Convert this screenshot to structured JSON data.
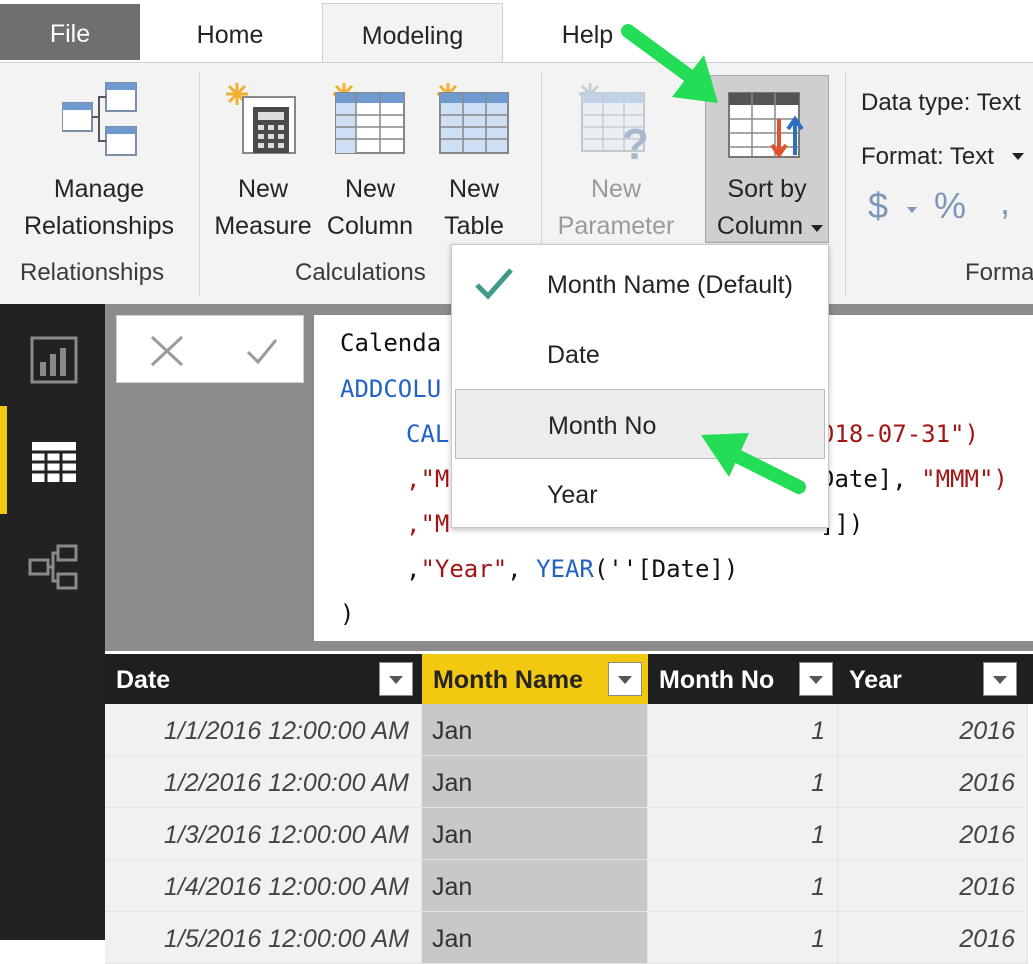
{
  "tabs": {
    "file": "File",
    "home": "Home",
    "modeling": "Modeling",
    "help": "Help"
  },
  "ribbon": {
    "manage": {
      "line1": "Manage",
      "line2": "Relationships"
    },
    "relationships_group": "Relationships",
    "new_measure": {
      "line1": "New",
      "line2": "Measure"
    },
    "new_column": {
      "line1": "New",
      "line2": "Column"
    },
    "new_table": {
      "line1": "New",
      "line2": "Table"
    },
    "calculations_group": "Calculations",
    "new_parameter": {
      "line1": "New",
      "line2": "Parameter"
    },
    "sort_by": {
      "line1": "Sort by",
      "line2": "Column"
    },
    "data_type": "Data type: Text",
    "format": "Format: Text",
    "currency_symbol": "$",
    "percent_symbol": "%",
    "comma_symbol": ",",
    "formatting_group": "Forma"
  },
  "dropdown": {
    "items": [
      "Month Name (Default)",
      "Date",
      "Month No",
      "Year"
    ],
    "checked": "Month Name (Default)",
    "highlighted": "Month No"
  },
  "formula": {
    "line1": "Calenda",
    "line2": "ADDCOLU",
    "line3a": "CAL",
    "line3b": "018-07-31\")",
    "line4a": ",\"M",
    "line4b": "Date], ",
    "line4c": "\"MMM\")",
    "line5a": ",\"M",
    "line5b": "]])",
    "line6a": ",",
    "line6b": "\"Year\"",
    "line6c": ", ",
    "line6d": "YEAR",
    "line6e": "(''[Date])",
    "line7": ")"
  },
  "table": {
    "headers": [
      "Date",
      "Month Name",
      "Month No",
      "Year"
    ],
    "rows": [
      [
        "1/1/2016 12:00:00 AM",
        "Jan",
        "1",
        "2016"
      ],
      [
        "1/2/2016 12:00:00 AM",
        "Jan",
        "1",
        "2016"
      ],
      [
        "1/3/2016 12:00:00 AM",
        "Jan",
        "1",
        "2016"
      ],
      [
        "1/4/2016 12:00:00 AM",
        "Jan",
        "1",
        "2016"
      ],
      [
        "1/5/2016 12:00:00 AM",
        "Jan",
        "1",
        "2016"
      ]
    ]
  },
  "colors": {
    "accent_yellow": "#f2c811",
    "annotation_arrow": "#22dd55",
    "dax_keyword": "#2262c6",
    "dax_string": "#a31515"
  }
}
